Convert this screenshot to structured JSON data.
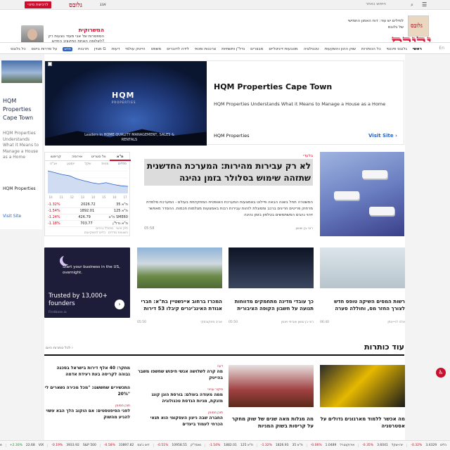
{
  "topbar": {
    "language": "אנג",
    "promo_button": "לרכישת מינוי",
    "small_logo": "גלובס",
    "search_text": "חיפוש באתר"
  },
  "header": {
    "logo": "גלובס",
    "promo_left": {
      "title": "המשרוקית",
      "subtitle": "הספסרות של אבי מעוד נוגעות רק לאלופה האחת התקציב החדש?"
    },
    "promo_right": {
      "thumb_text": "גלובס",
      "text": "למילים יש עוד: דוח האמון החמישי של גלובס"
    }
  },
  "nav": {
    "en": "En",
    "items": [
      "ראשי",
      "גלובס פיננסי",
      "כל הכותרות",
      "שוק ההון והשקעות",
      "טכנולוגיה",
      "מטבעות דיגיטליים",
      "מבצרים",
      "נדל\"ן ותשתיות",
      "צרכנות ופנאי",
      "לידה לדוברים",
      "משפט",
      "הייטק עולמי",
      "דעות",
      "מגזין G",
      "תרבות",
      "חדש",
      "על סדרות ביזנס",
      "כל גלובס"
    ],
    "badge_index": 15,
    "active_index": 0
  },
  "left_ad": {
    "title": "HQM Properties Cape Town",
    "desc": "HQM Properties Understands What it Means to Manage a House as a Home",
    "brand": "HQM Properties",
    "visit": "Visit Site"
  },
  "big_ad": {
    "logo": "HQM",
    "logo_sub": "PROPERTIES",
    "tagline": "Leaders in HOME QUALITY MANAGEMENT, SALES & RENTALS",
    "title": "HQM Properties Cape Town",
    "desc": "HQM Properties Understands What it Means to Manage a House as a Home",
    "brand": "HQM Properties",
    "visit": "Visit Site"
  },
  "market": {
    "tabs": [
      "ת\"א",
      "וול סטריט",
      "אירופה",
      "קריפטו"
    ],
    "subtabs": [
      "מדדים",
      "מניות",
      "שקל",
      "יוסטון",
      "אג\"ח"
    ],
    "chart": {
      "type": "area",
      "x_labels": [
        "10",
        "11",
        "12",
        "13",
        "14",
        "15",
        "16",
        "17"
      ],
      "values": [
        3.4,
        3.1,
        2.8,
        2.6,
        2.1,
        1.8,
        1.5,
        1.3,
        1.5,
        1.2,
        1.0,
        0.9
      ]
    },
    "rows": [
      {
        "name": "ת\"א 35",
        "value": "2026.72",
        "change": "-1.32%",
        "dir": "neg"
      },
      {
        "name": "ת\"א 125",
        "value": "1892.01",
        "change": "-1.54%",
        "dir": "neg"
      },
      {
        "name": "ת\"א SME60",
        "value": "426.79",
        "change": "-1.24%",
        "dir": "neg"
      },
      {
        "name": "ת\"א נדל\"ן",
        "value": "703.77",
        "change": "-1.18%",
        "dir": "neg"
      }
    ],
    "footer": [
      "תיק אישי",
      "מחולל גרפים",
      "השוואת מדדים",
      "כלים למשקיעים"
    ]
  },
  "main_story": {
    "kicker": "בלעדי",
    "headline": "לא רק עבירות מהירות: המערכת החדשנית שתזהה שימוש בסלולר בזמן נהיגה",
    "summary": "המשטרה תחל בשנה הבאה פיילוט באמצעות המערכת האופטית המתקדמת בעולם - המערכת מלמדת מרחוק פריטים חריגים ברכב ומסוגלת לזהות עבירות רבות באמצעות מצלמות חכמות. ההסדר מאפשר זיהוי נהגים המשתמשים בטלפון בזמן נהיגה",
    "author": "רוני בן שושן",
    "time": "05:58"
  },
  "cards": [
    {
      "title": "רשות המסים השיקה טופס חדש לצורך החזר מס, וחוללה סערה",
      "author": "אלה לוי-יונתן",
      "time": "06:40"
    },
    {
      "title": "כך עובדי מדינה מתחמקים מדווחות תנועה על חשבון הקופה הציבורית",
      "author": "רוני בן שושן ואביחי ויצמן",
      "time": "05:50"
    },
    {
      "title": "המכרז ברחוב איינשטיין בת\"א: חברי אגודת האינג'ינרים קיבלו 53 דירות",
      "author": "אביב מינקובסקי",
      "time": "05:50"
    }
  ],
  "ad_card": {
    "line1": "Start your business in the US, overnight.",
    "line2": "Trusted by 13,000+ founders",
    "brand": "Firstbase.io",
    "arrow": "›"
  },
  "more": {
    "title": "עוד כותרות",
    "link": "לכל כותרות היום ›",
    "features": [
      {
        "title": "מה אכשר ללמוד מארגונים גדולים על אסטרטגיה",
        "image": "greek-temple"
      },
      {
        "title": "מה מגלות מאה שנים של שוק מחקר על קריסות בשוק המניות",
        "image": "bear-market"
      }
    ],
    "list_a": [
      {
        "cat": "דעה",
        "h": "מה קרה לשלושה אנשי חיפוש שחשפו משבר בהייטק"
      },
      {
        "cat": "סיקור ענייני",
        "h": "ממה מעודה בעולם: בורסת הוגן קונג מזנקת, מניות הנדסת טכנולוגיה"
      },
      {
        "cat": "תוכן ממומן",
        "h": "החברה שבה ניעון העסקומי הוא תנאי הכרחי לעמוד ביעדים"
      }
    ],
    "list_b": [
      {
        "cat": "",
        "h": "מחקר: 40 אלף דירות בישראל בסכנה גבוהה לקריסה בעת רעידת אדמה"
      },
      {
        "cat": "",
        "h": "התכשירים שחששנו: \"מכל מכירה נשארים לי 20%\""
      },
      {
        "cat": "תוכן ממומן",
        "h": "לפני הסיפטסטים: אם הוקוב הלך הבא עשוי להגיע מהשוק"
      }
    ]
  },
  "ticker": [
    {
      "name": "כלים",
      "value": "3.4329",
      "change": "-0.32%",
      "dir": "neg"
    },
    {
      "name": "יורו-שקל",
      "value": "3.6041",
      "change": "-0.35%",
      "dir": "neg"
    },
    {
      "name": "אירוקנטרל",
      "value": "1.0489",
      "change": "-0.06%",
      "dir": "neg"
    },
    {
      "name": "ת\"א 35",
      "value": "1826.93",
      "change": "-1.32%",
      "dir": "neg"
    },
    {
      "name": "ת\"א 125",
      "value": "1882.01",
      "change": "-1.54%",
      "dir": "neg"
    },
    {
      "name": "נאסד\"ק",
      "value": "10958.55",
      "change": "-0.51%",
      "dir": "neg"
    },
    {
      "name": "דאו ג'ונס",
      "value": "33897.82",
      "change": "-0.58%",
      "dir": "neg"
    },
    {
      "name": "S&P 500",
      "value": "3933.92",
      "change": "-0.19%",
      "dir": "neg"
    },
    {
      "name": "VIX",
      "value": "22.68",
      "change": "+2.30%",
      "dir": "pos"
    },
    {
      "name": "Apple",
      "value": "148.94",
      "change": "-1.36%",
      "dir": "neg"
    }
  ],
  "colors": {
    "brand": "#c8102e",
    "link": "#2b63c7",
    "neg": "#d0021b",
    "pos": "#1a8f2e"
  }
}
